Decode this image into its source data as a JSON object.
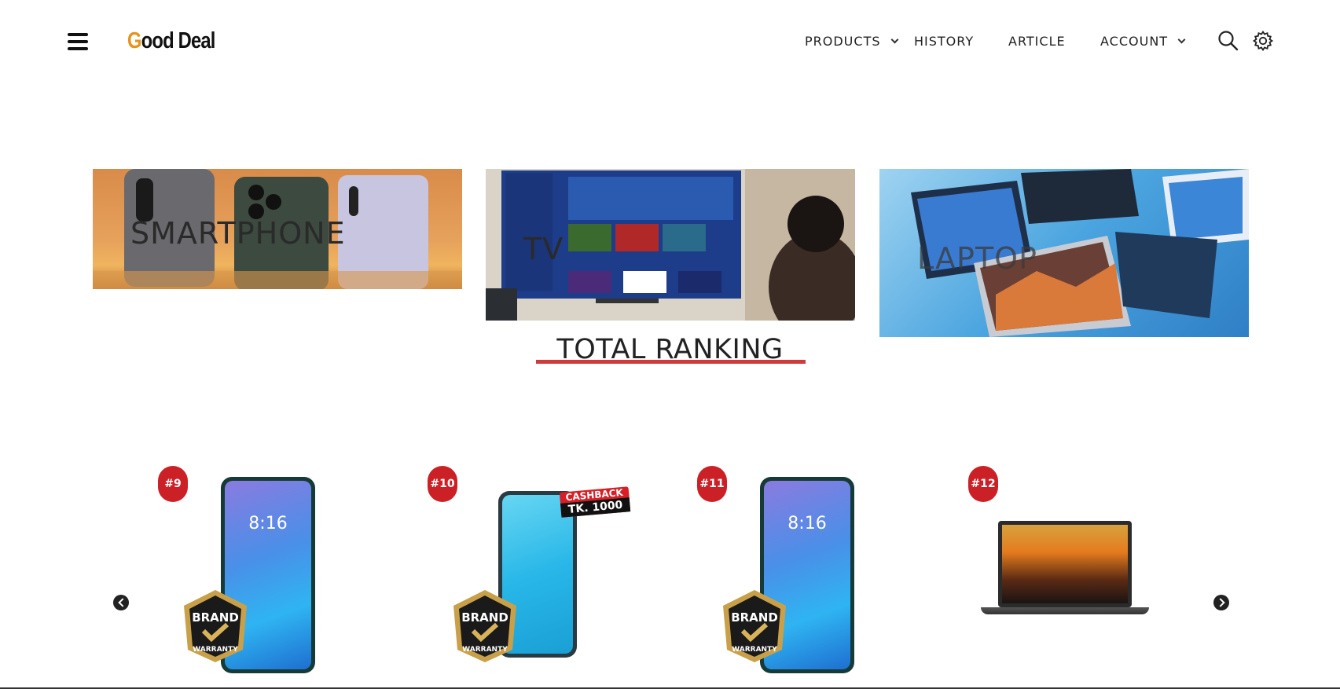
{
  "header": {
    "logo_accent": "G",
    "logo_rest": "ood Deal",
    "nav": {
      "products": "PRODUCTS",
      "history": "HISTORY",
      "article": "ARTICLE",
      "account": "ACCOUNT"
    }
  },
  "banners": [
    {
      "label": "SMARTPHONE"
    },
    {
      "label": "TV"
    },
    {
      "label": "LAPTOP"
    }
  ],
  "ranking": {
    "title": "TOTAL RANKING"
  },
  "products": [
    {
      "rank": "#9"
    },
    {
      "rank": "#10",
      "cashback_label": "CASHBACK",
      "cashback_amount": "TK. 1000"
    },
    {
      "rank": "#11"
    },
    {
      "rank": "#12"
    }
  ],
  "phone_screen": {
    "time": "8:16"
  },
  "colors": {
    "accent_logo": "#e6931d",
    "ranking_underline": "#d13a3a",
    "rank_badge": "#cc2027"
  }
}
